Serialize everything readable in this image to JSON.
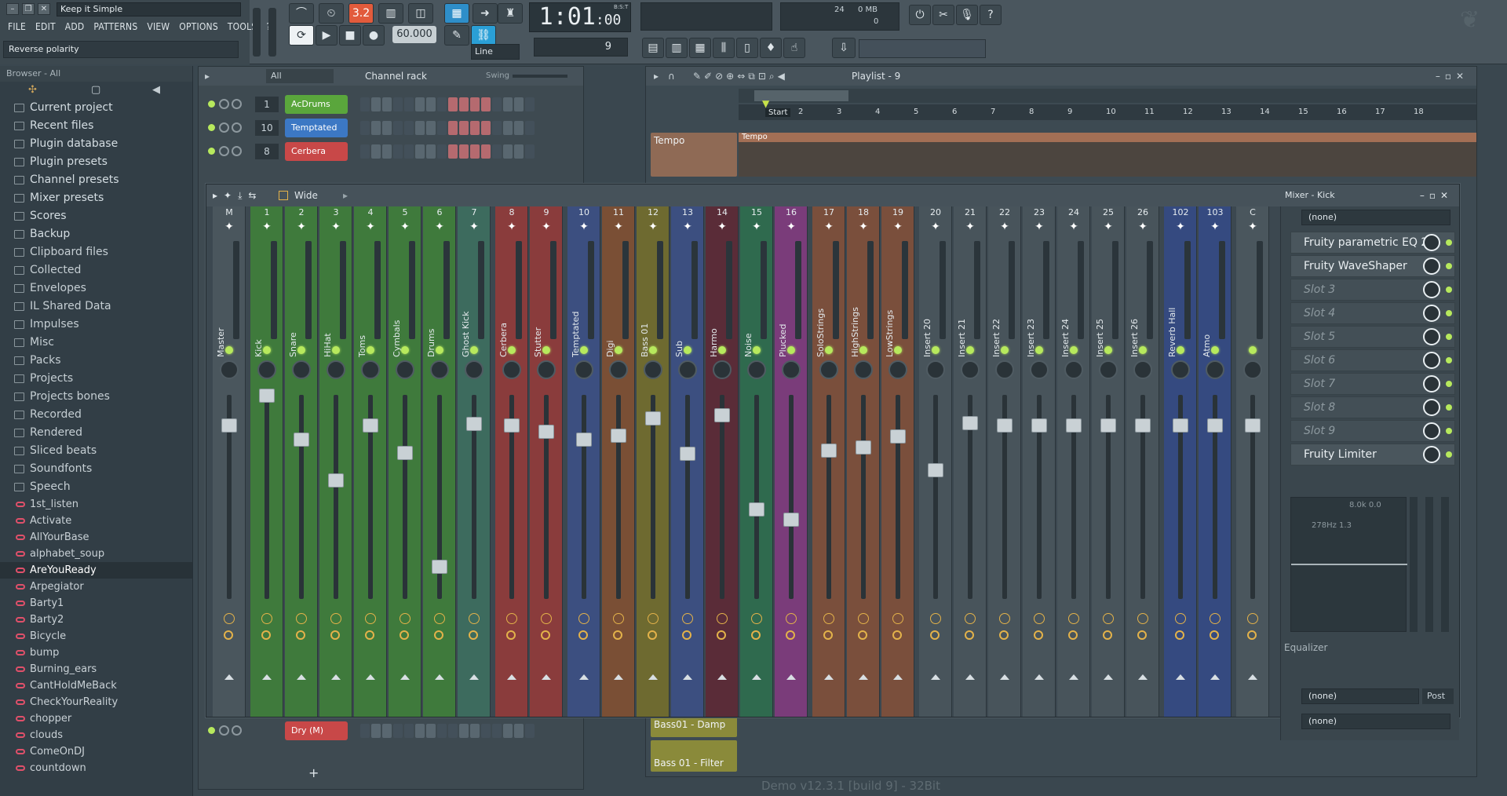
{
  "window": {
    "song_title": "Keep it Simple",
    "hint": "Reverse polarity"
  },
  "menu": [
    "FILE",
    "EDIT",
    "ADD",
    "PATTERNS",
    "VIEW",
    "OPTIONS",
    "TOOLS",
    "?"
  ],
  "transport": {
    "pattern_indicator": "3.2",
    "time": "1:01",
    "time_small": ":00",
    "time_unit": "B:S:T",
    "tempo": "60.000",
    "snap": "Line",
    "pattern_num": "9",
    "cpu": "24",
    "mem": "0 MB",
    "polyphony": "0"
  },
  "browser": {
    "header": "Browser - All",
    "folders_top": [
      "Current project",
      "Recent files",
      "Plugin database",
      "Plugin presets",
      "Channel presets",
      "Mixer presets",
      "Scores",
      "Backup"
    ],
    "folders": [
      "Clipboard files",
      "Collected",
      "Envelopes",
      "IL Shared Data",
      "Impulses",
      "Misc",
      "Packs",
      "Projects",
      "Projects bones",
      "Recorded",
      "Rendered",
      "Sliced beats",
      "Soundfonts",
      "Speech"
    ],
    "files": [
      "1st_listen",
      "Activate",
      "AllYourBase",
      "alphabet_soup",
      "AreYouReady",
      "Arpegiator",
      "Barty1",
      "Barty2",
      "Bicycle",
      "bump",
      "Burning_ears",
      "CantHoldMeBack",
      "CheckYourReality",
      "chopper",
      "clouds",
      "ComeOnDJ",
      "countdown"
    ],
    "selected": "AreYouReady"
  },
  "channel_rack": {
    "title": "Channel rack",
    "filter": "All",
    "swing": "Swing",
    "channels": [
      {
        "num": "1",
        "name": "AcDrums",
        "color": "#5aa63c"
      },
      {
        "num": "10",
        "name": "Temptated",
        "color": "#3c78c4"
      },
      {
        "num": "8",
        "name": "Cerbera",
        "color": "#c84848"
      }
    ],
    "bottom_channel": {
      "name": "Dry (M)",
      "color": "#c84848"
    },
    "add_label": "+"
  },
  "playlist": {
    "title": "Playlist - 9",
    "bars": [
      "2",
      "3",
      "4",
      "5",
      "6",
      "7",
      "8",
      "9",
      "10",
      "11",
      "12",
      "13",
      "14",
      "15",
      "16",
      "17",
      "18"
    ],
    "start_marker": "Start",
    "tracks": [
      {
        "name": "Tempo",
        "clip": "Tempo",
        "color": "#9a6e58"
      },
      {
        "name": "Bass01 - Damp",
        "color": "#8a8a3a"
      },
      {
        "name": "Bass 01 - Filter",
        "color": "#8a8a3a"
      }
    ]
  },
  "mixer": {
    "view_mode": "Wide",
    "panel_title": "Mixer - Kick",
    "strips": [
      {
        "num": "M",
        "label": "Master",
        "color": "#4a565d"
      },
      {
        "num": "1",
        "label": "Kick",
        "color": "#3f7a3c"
      },
      {
        "num": "2",
        "label": "Snare",
        "color": "#3f7a3c"
      },
      {
        "num": "3",
        "label": "HiHat",
        "color": "#3f7a3c"
      },
      {
        "num": "4",
        "label": "Toms",
        "color": "#3f7a3c"
      },
      {
        "num": "5",
        "label": "Cymbals",
        "color": "#3f7a3c"
      },
      {
        "num": "6",
        "label": "Drums",
        "color": "#3f7a3c"
      },
      {
        "num": "7",
        "label": "Ghost Kick",
        "color": "#3d6b5e"
      },
      {
        "num": "8",
        "label": "Cerbera",
        "color": "#8a3c3c"
      },
      {
        "num": "9",
        "label": "Stutter",
        "color": "#8a3c3c"
      },
      {
        "num": "10",
        "label": "Temptated",
        "color": "#3c4f80"
      },
      {
        "num": "11",
        "label": "Digi",
        "color": "#7a4f35"
      },
      {
        "num": "12",
        "label": "Bass 01",
        "color": "#6e6a30"
      },
      {
        "num": "13",
        "label": "Sub",
        "color": "#3c4f80"
      },
      {
        "num": "14",
        "label": "Harmo",
        "color": "#5a2c38"
      },
      {
        "num": "15",
        "label": "Noise",
        "color": "#2f6a4e"
      },
      {
        "num": "16",
        "label": "Plucked",
        "color": "#7a3c7a"
      },
      {
        "num": "17",
        "label": "SoloStrings",
        "color": "#7a4f3c"
      },
      {
        "num": "18",
        "label": "HighStrings",
        "color": "#7a4f3c"
      },
      {
        "num": "19",
        "label": "LowStrings",
        "color": "#7a4f3c"
      },
      {
        "num": "20",
        "label": "Insert 20",
        "color": "#48545b"
      },
      {
        "num": "21",
        "label": "Insert 21",
        "color": "#48545b"
      },
      {
        "num": "22",
        "label": "Insert 22",
        "color": "#48545b"
      },
      {
        "num": "23",
        "label": "Insert 23",
        "color": "#48545b"
      },
      {
        "num": "24",
        "label": "Insert 24",
        "color": "#48545b"
      },
      {
        "num": "25",
        "label": "Insert 25",
        "color": "#48545b"
      },
      {
        "num": "26",
        "label": "Insert 26",
        "color": "#48545b"
      },
      {
        "num": "102",
        "label": "Reverb Hall",
        "color": "#354a80"
      },
      {
        "num": "103",
        "label": "Atmo",
        "color": "#354a80"
      },
      {
        "num": "C",
        "label": "",
        "color": "#4a565d"
      }
    ],
    "slots": [
      {
        "name": "Fruity parametric EQ 2",
        "empty": false
      },
      {
        "name": "Fruity WaveShaper",
        "empty": false
      },
      {
        "name": "Slot 3",
        "empty": true
      },
      {
        "name": "Slot 4",
        "empty": true
      },
      {
        "name": "Slot 5",
        "empty": true
      },
      {
        "name": "Slot 6",
        "empty": true
      },
      {
        "name": "Slot 7",
        "empty": true
      },
      {
        "name": "Slot 8",
        "empty": true
      },
      {
        "name": "Slot 9",
        "empty": true
      },
      {
        "name": "Fruity Limiter",
        "empty": false
      }
    ],
    "input": "(none)",
    "output": "(none)",
    "output2": "(none)",
    "post": "Post",
    "eq_label": "Equalizer",
    "eq_readout1": "8.0k 0.0",
    "eq_readout2": "278Hz 1.3"
  },
  "footer": {
    "version": "Demo v12.3.1 [build 9] - 32Bit"
  }
}
